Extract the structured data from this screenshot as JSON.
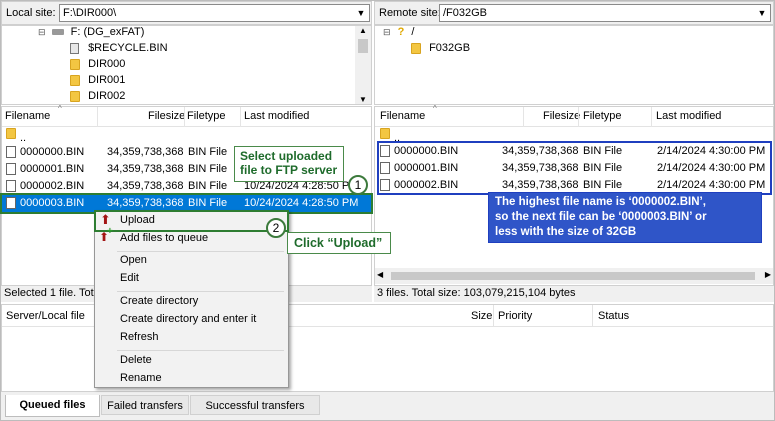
{
  "local": {
    "label": "Local site:",
    "path": "F:\\DIR000\\",
    "tree": [
      "F: (DG_exFAT)",
      "$RECYCLE.BIN",
      "DIR000",
      "DIR001",
      "DIR002"
    ],
    "columns": [
      "Filename",
      "Filesize",
      "Filetype",
      "Last modified"
    ],
    "parent": "..",
    "files": [
      {
        "name": "0000000.BIN",
        "size": "34,359,738,368",
        "type": "BIN File",
        "modified": ""
      },
      {
        "name": "0000001.BIN",
        "size": "34,359,738,368",
        "type": "BIN File",
        "modified": ""
      },
      {
        "name": "0000002.BIN",
        "size": "34,359,738,368",
        "type": "BIN File",
        "modified": "10/24/2024 4:28:50 PM"
      },
      {
        "name": "0000003.BIN",
        "size": "34,359,738,368",
        "type": "BIN File",
        "modified": "10/24/2024 4:28:50 PM"
      }
    ],
    "status": "Selected 1 file. Total"
  },
  "remote": {
    "label": "Remote site:",
    "path": "/F032GB",
    "tree": [
      "/",
      "F032GB"
    ],
    "columns": [
      "Filename",
      "Filesize",
      "Filetype",
      "Last modified"
    ],
    "parent": "..",
    "files": [
      {
        "name": "0000000.BIN",
        "size": "34,359,738,368",
        "type": "BIN File",
        "modified": "2/14/2024 4:30:00 PM"
      },
      {
        "name": "0000001.BIN",
        "size": "34,359,738,368",
        "type": "BIN File",
        "modified": "2/14/2024 4:30:00 PM"
      },
      {
        "name": "0000002.BIN",
        "size": "34,359,738,368",
        "type": "BIN File",
        "modified": "2/14/2024 4:30:00 PM"
      }
    ],
    "status": "3 files. Total size: 103,079,215,104 bytes"
  },
  "context_menu": {
    "upload": "Upload",
    "add_to_queue": "Add files to queue",
    "open": "Open",
    "edit": "Edit",
    "create_dir": "Create directory",
    "create_dir_enter": "Create directory and enter it",
    "refresh": "Refresh",
    "delete": "Delete",
    "rename": "Rename"
  },
  "queue": {
    "col_server_local": "Server/Local file",
    "col_size": "Size",
    "col_priority": "Priority",
    "col_status": "Status"
  },
  "tabs": [
    "Queued files",
    "Failed transfers",
    "Successful transfers"
  ],
  "annotations": {
    "step1_text_line1": "Select uploaded",
    "step1_text_line2": "file to FTP server",
    "step1_num": "1",
    "step2_text": "Click “Upload”",
    "step2_num": "2",
    "note_line1": "The highest file name is ‘0000002.BIN’,",
    "note_line2": "so the next file can be ‘0000003.BIN’ or",
    "note_line3": "less with the size of 32GB"
  },
  "colors": {
    "selection": "#0078d7",
    "highlight_green": "#2e7d32",
    "blue_box": "#1f3fbf",
    "note_bg": "#2f55c8"
  }
}
